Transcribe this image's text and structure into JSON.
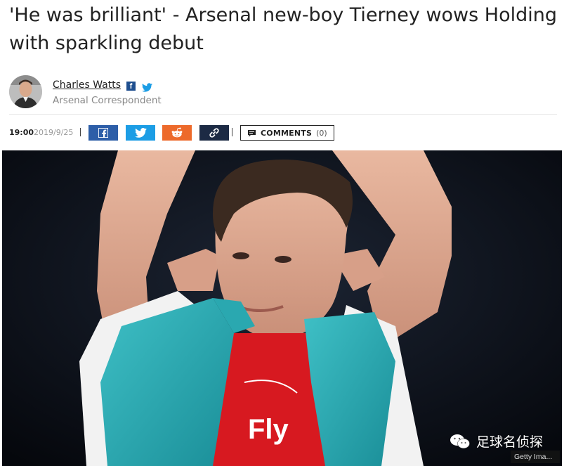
{
  "article": {
    "headline": "'He was brilliant' - Arsenal new-boy Tierney wows Holding with sparkling debut"
  },
  "author": {
    "name": "Charles Watts",
    "role": "Arsenal Correspondent",
    "avatar_icon": "author-avatar",
    "social_icons": [
      "facebook-icon",
      "twitter-icon"
    ]
  },
  "meta": {
    "time": "19:00",
    "date": "2019/9/25"
  },
  "share": {
    "buttons": [
      {
        "icon": "facebook-icon",
        "color": "#2d5ea8"
      },
      {
        "icon": "twitter-icon",
        "color": "#1c9de5"
      },
      {
        "icon": "reddit-icon",
        "color": "#ed6a2b"
      },
      {
        "icon": "link-icon",
        "color": "#1c2a44"
      }
    ],
    "comments_label": "COMMENTS",
    "comments_count": "(0)"
  },
  "image": {
    "watermark_text": "足球名侦探",
    "credit": "Getty Ima..."
  }
}
